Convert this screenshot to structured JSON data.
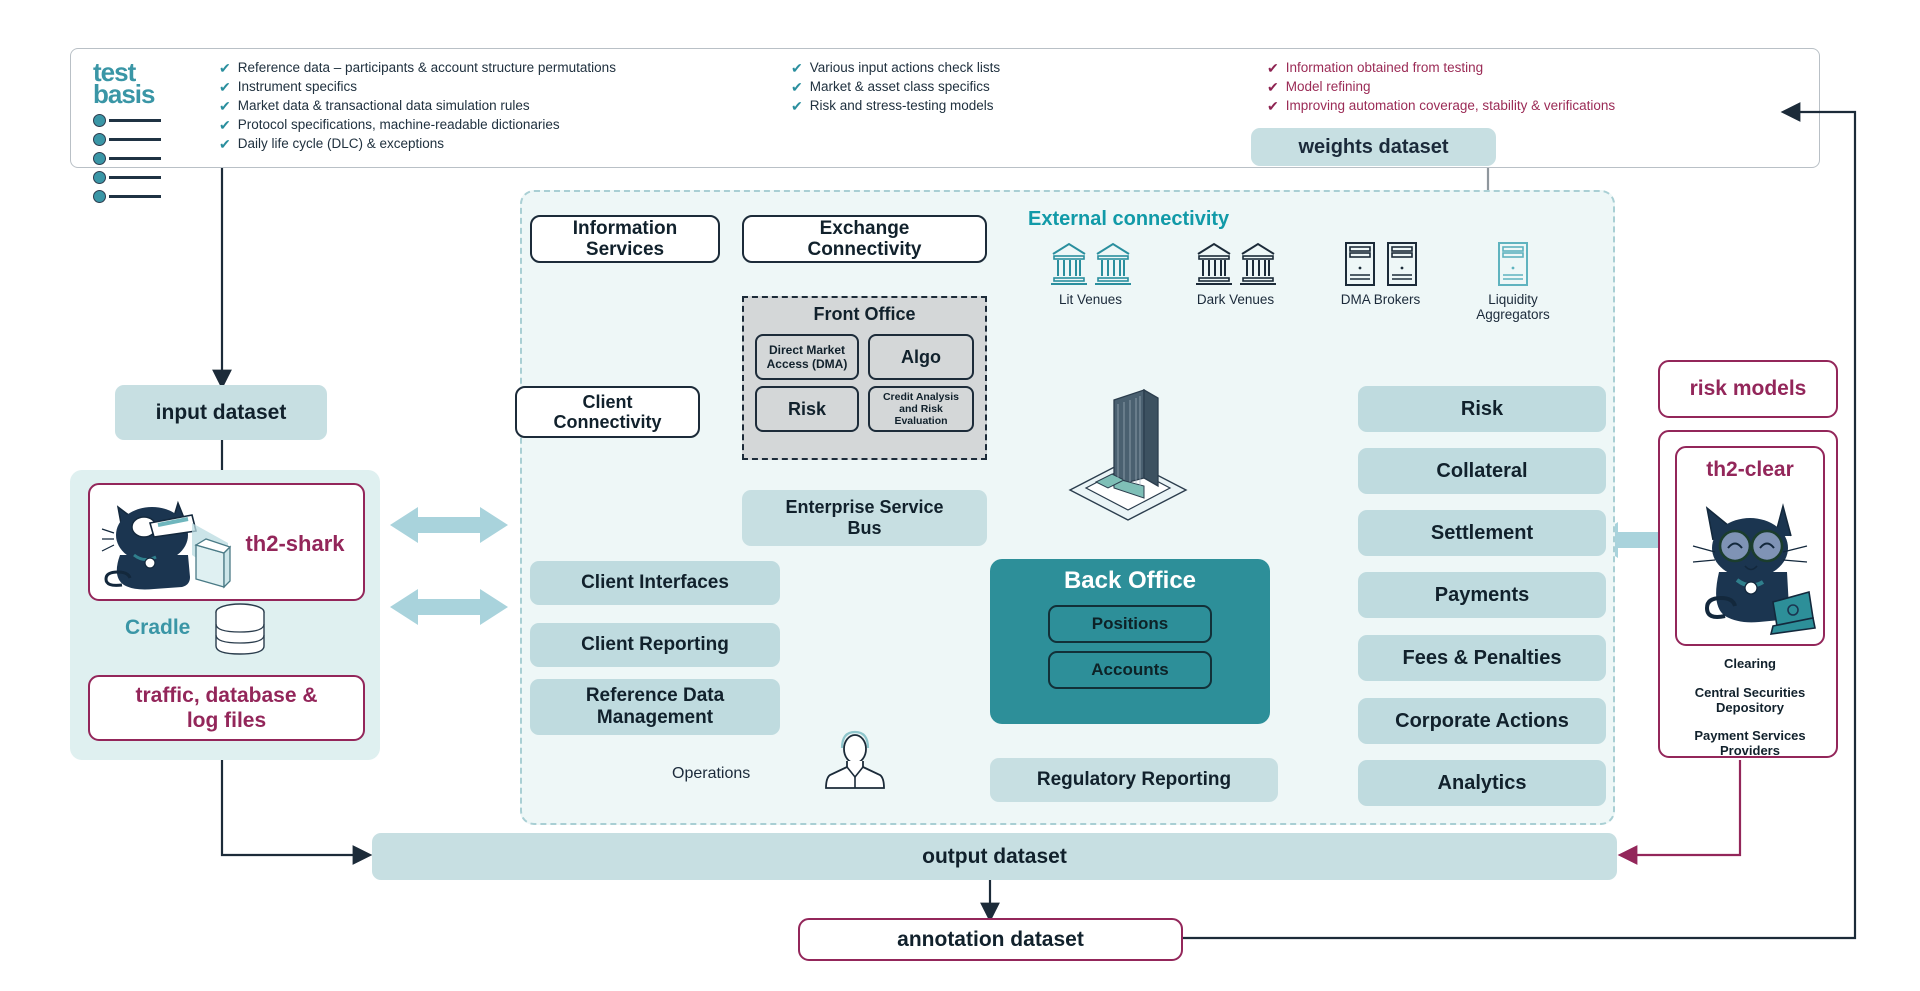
{
  "test_basis": {
    "logo_line1": "test",
    "logo_line2": "basis",
    "column1": [
      "Reference data – participants & account structure permutations",
      "Instrument specifics",
      "Market data & transactional data simulation rules",
      "Protocol specifications, machine-readable dictionaries",
      "Daily life cycle (DLC) & exceptions"
    ],
    "column2": [
      "Various input actions check lists",
      "Market & asset class specifics",
      "Risk and stress-testing models"
    ],
    "column3": [
      "Information obtained from testing",
      "Model refining",
      "Improving automation coverage, stability & verifications"
    ]
  },
  "datasets": {
    "weights": "weights dataset",
    "input": "input dataset",
    "output": "output dataset",
    "annotation": "annotation dataset",
    "risk_models": "risk models"
  },
  "shark": {
    "title": "th2-shark",
    "cradle": "Cradle",
    "files": "traffic, database &\nlog files",
    "files_line1": "traffic, database &",
    "files_line2": "log files"
  },
  "clear": {
    "title": "th2-clear",
    "captions": [
      "Clearing",
      "Central Securities Depository",
      "Payment Services Providers"
    ],
    "caption1": "Clearing",
    "caption2_line1": "Central Securities",
    "caption2_line2": "Depository",
    "caption3_line1": "Payment Services",
    "caption3_line2": "Providers"
  },
  "core": {
    "information_services_line1": "Information",
    "information_services_line2": "Services",
    "exchange_connectivity_line1": "Exchange",
    "exchange_connectivity_line2": "Connectivity",
    "client_connectivity_line1": "Client",
    "client_connectivity_line2": "Connectivity",
    "front_office_title": "Front Office",
    "front_office_items": [
      "Direct Market Access (DMA)",
      "Algo",
      "Risk",
      "Credit Analysis and Risk Evaluation"
    ],
    "dma_line1": "Direct Market",
    "dma_line2": "Access (DMA)",
    "algo": "Algo",
    "fo_risk": "Risk",
    "credit_line1": "Credit Analysis",
    "credit_line2": "and Risk",
    "credit_line3": "Evaluation",
    "esb_line1": "Enterprise Service",
    "esb_line2": "Bus",
    "back_office_title": "Back Office",
    "back_office_items": [
      "Positions",
      "Accounts"
    ],
    "positions": "Positions",
    "accounts": "Accounts",
    "regulatory_reporting": "Regulatory Reporting",
    "operations_title": "Operations",
    "operations_items": [
      "Client Interfaces",
      "Client Reporting",
      "Reference Data Management"
    ],
    "client_interfaces": "Client Interfaces",
    "client_reporting": "Client Reporting",
    "rdm_line1": "Reference Data",
    "rdm_line2": "Management",
    "external_connectivity_title": "External connectivity",
    "external_nodes": [
      {
        "label": "Lit Venues",
        "icon": "bank-icon",
        "count": 2,
        "color": "#2a8f9e"
      },
      {
        "label": "Dark Venues",
        "icon": "bank-icon",
        "count": 2,
        "color": "#1c2b39"
      },
      {
        "label": "DMA Brokers",
        "icon": "server-icon",
        "count": 2,
        "color": "#1c2b39"
      },
      {
        "label": "Liquidity Aggregators",
        "icon": "server-icon",
        "count": 1,
        "color": "#5fb3bf"
      }
    ],
    "services_right": [
      "Risk",
      "Collateral",
      "Settlement",
      "Payments",
      "Fees & Penalties",
      "Corporate Actions",
      "Analytics"
    ]
  },
  "colors": {
    "teal": "#1a9aab",
    "deep_teal": "#2d8f99",
    "plum": "#93265a",
    "pale_blue": "#c7dfe2",
    "dark_navy": "#1c2b39",
    "region_bg": "#eef7f7",
    "arrow_pale": "#a9d3dc"
  }
}
